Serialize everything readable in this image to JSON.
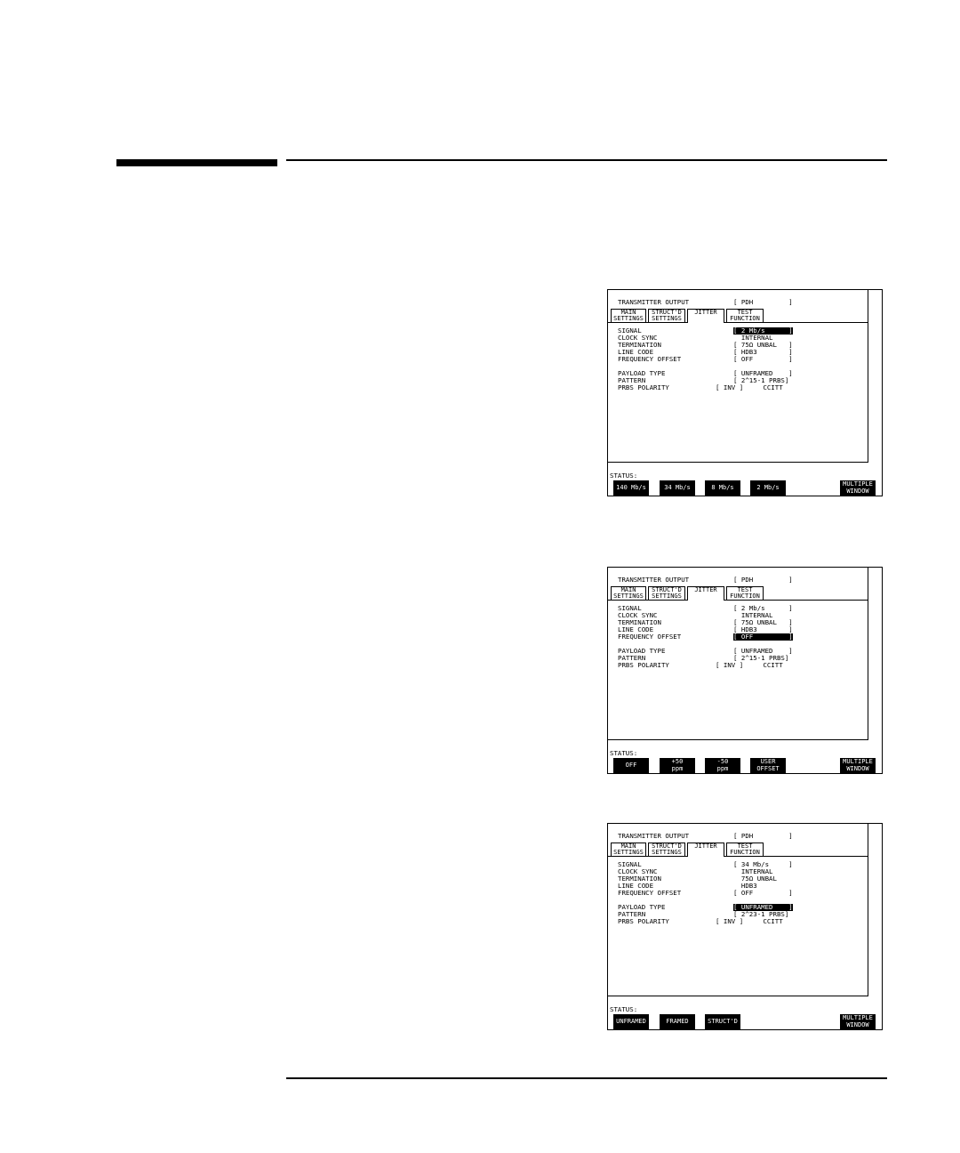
{
  "screens": [
    {
      "transmitter_label": "TRANSMITTER OUTPUT",
      "transmitter_value": "[ PDH         ]",
      "tabs": [
        {
          "l1": "MAIN",
          "l2": "SETTINGS"
        },
        {
          "l1": "STRUCT'D",
          "l2": "SETTINGS"
        },
        {
          "l1": "JITTER",
          "l2": ""
        },
        {
          "l1": "TEST",
          "l2": "FUNCTION"
        }
      ],
      "params": [
        {
          "label": "SIGNAL",
          "value": "[ 2 Mb/s      ]"
        },
        {
          "label": "CLOCK SYNC",
          "value": "  INTERNAL"
        },
        {
          "label": "TERMINATION",
          "value": "[ 75Ω UNBAL   ]"
        },
        {
          "label": "LINE CODE",
          "value": "[ HDB3        ]"
        },
        {
          "label": "FREQUENCY OFFSET",
          "value": "[ OFF         ]"
        },
        {
          "label": "PAYLOAD TYPE",
          "value": "[ UNFRAMED    ]"
        },
        {
          "label": "PATTERN",
          "value": "[ 2^15-1 PRBS]"
        },
        {
          "label": "PRBS POLARITY",
          "value": "[ INV ]     CCITT"
        }
      ],
      "highlight_index": 0,
      "status": "STATUS:",
      "softkeys": [
        {
          "l1": "140 Mb/s",
          "l2": ""
        },
        {
          "l1": "34 Mb/s",
          "l2": ""
        },
        {
          "l1": "8 Mb/s",
          "l2": ""
        },
        {
          "l1": "2 Mb/s",
          "l2": ""
        },
        {
          "l1": "MULTIPLE",
          "l2": "WINDOW"
        }
      ]
    },
    {
      "transmitter_label": "TRANSMITTER OUTPUT",
      "transmitter_value": "[ PDH         ]",
      "tabs": [
        {
          "l1": "MAIN",
          "l2": "SETTINGS"
        },
        {
          "l1": "STRUCT'D",
          "l2": "SETTINGS"
        },
        {
          "l1": "JITTER",
          "l2": ""
        },
        {
          "l1": "TEST",
          "l2": "FUNCTION"
        }
      ],
      "params": [
        {
          "label": "SIGNAL",
          "value": "[ 2 Mb/s      ]"
        },
        {
          "label": "CLOCK SYNC",
          "value": "  INTERNAL"
        },
        {
          "label": "TERMINATION",
          "value": "[ 75Ω UNBAL   ]"
        },
        {
          "label": "LINE CODE",
          "value": "[ HDB3        ]"
        },
        {
          "label": "FREQUENCY OFFSET",
          "value": "[ OFF         ]"
        },
        {
          "label": "PAYLOAD TYPE",
          "value": "[ UNFRAMED    ]"
        },
        {
          "label": "PATTERN",
          "value": "[ 2^15-1 PRBS]"
        },
        {
          "label": "PRBS POLARITY",
          "value": "[ INV ]     CCITT"
        }
      ],
      "highlight_index": 4,
      "status": "STATUS:",
      "softkeys": [
        {
          "l1": "OFF",
          "l2": ""
        },
        {
          "l1": "+50",
          "l2": "ppm"
        },
        {
          "l1": "-50",
          "l2": "ppm"
        },
        {
          "l1": "USER",
          "l2": "OFFSET"
        },
        {
          "l1": "MULTIPLE",
          "l2": "WINDOW"
        }
      ]
    },
    {
      "transmitter_label": "TRANSMITTER OUTPUT",
      "transmitter_value": "[ PDH         ]",
      "tabs": [
        {
          "l1": "MAIN",
          "l2": "SETTINGS"
        },
        {
          "l1": "STRUCT'D",
          "l2": "SETTINGS"
        },
        {
          "l1": "JITTER",
          "l2": ""
        },
        {
          "l1": "TEST",
          "l2": "FUNCTION"
        }
      ],
      "params": [
        {
          "label": "SIGNAL",
          "value": "[ 34 Mb/s     ]"
        },
        {
          "label": "CLOCK SYNC",
          "value": "  INTERNAL"
        },
        {
          "label": "TERMINATION",
          "value": "  75Ω UNBAL"
        },
        {
          "label": "LINE CODE",
          "value": "  HDB3"
        },
        {
          "label": "FREQUENCY OFFSET",
          "value": "[ OFF         ]"
        },
        {
          "label": "PAYLOAD TYPE",
          "value": "[ UNFRAMED    ]"
        },
        {
          "label": "PATTERN",
          "value": "[ 2^23-1 PRBS]"
        },
        {
          "label": "PRBS POLARITY",
          "value": "[ INV ]     CCITT"
        }
      ],
      "highlight_index": 5,
      "status": "STATUS:",
      "softkeys": [
        {
          "l1": "UNFRAMED",
          "l2": ""
        },
        {
          "l1": "FRAMED",
          "l2": ""
        },
        {
          "l1": "STRUCT'D",
          "l2": ""
        },
        {
          "l1": "",
          "l2": ""
        },
        {
          "l1": "MULTIPLE",
          "l2": "WINDOW"
        }
      ]
    }
  ]
}
